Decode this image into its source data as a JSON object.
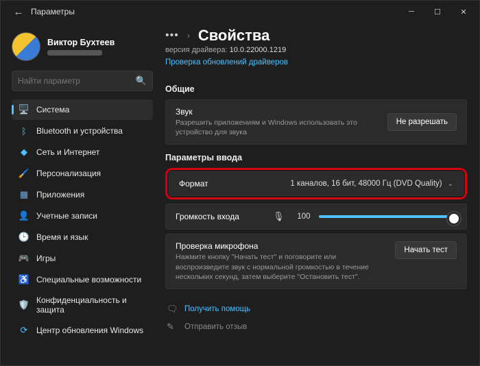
{
  "window": {
    "title": "Параметры"
  },
  "user": {
    "name": "Виктор Бухтеев"
  },
  "search": {
    "placeholder": "Найти параметр"
  },
  "nav": {
    "items": [
      {
        "icon": "🖥️",
        "label": "Система",
        "name": "nav-system",
        "active": true
      },
      {
        "icon": "ᛒ",
        "label": "Bluetooth и устройства",
        "name": "nav-bluetooth",
        "iconColor": "#4cc2ff"
      },
      {
        "icon": "◆",
        "label": "Сеть и Интернет",
        "name": "nav-network",
        "iconColor": "#4cc2ff"
      },
      {
        "icon": "🖌️",
        "label": "Персонализация",
        "name": "nav-personalization"
      },
      {
        "icon": "▦",
        "label": "Приложения",
        "name": "nav-apps",
        "iconColor": "#6fa8dc"
      },
      {
        "icon": "👤",
        "label": "Учетные записи",
        "name": "nav-accounts"
      },
      {
        "icon": "🕒",
        "label": "Время и язык",
        "name": "nav-time"
      },
      {
        "icon": "🎮",
        "label": "Игры",
        "name": "nav-gaming"
      },
      {
        "icon": "♿",
        "label": "Специальные возможности",
        "name": "nav-accessibility"
      },
      {
        "icon": "🛡️",
        "label": "Конфиденциальность и защита",
        "name": "nav-privacy"
      },
      {
        "icon": "⟳",
        "label": "Центр обновления Windows",
        "name": "nav-update",
        "iconColor": "#4cc2ff"
      }
    ]
  },
  "main": {
    "breadcrumb_title": "Свойства",
    "driver_label": "версия драйвера:",
    "driver_value": "10.0.22000.1219",
    "check_updates": "Проверка обновлений драйверов",
    "section_general": "Общие",
    "sound_card": {
      "title": "Звук",
      "desc": "Разрешить приложениям и Windows использовать это устройство для звука",
      "button": "Не разрешать"
    },
    "section_input": "Параметры ввода",
    "format": {
      "label": "Формат",
      "value": "1 каналов, 16 бит, 48000 Гц (DVD Quality)"
    },
    "volume": {
      "label": "Громкость входа",
      "value": "100"
    },
    "mic_test": {
      "title": "Проверка микрофона",
      "desc": "Нажмите кнопку \"Начать тест\" и поговорите или воспроизведите звук с нормальной громкостью в течение нескольких секунд, затем выберите \"Остановить тест\".",
      "button": "Начать тест"
    },
    "help": "Получить помощь",
    "feedback": "Отправить отзыв"
  }
}
